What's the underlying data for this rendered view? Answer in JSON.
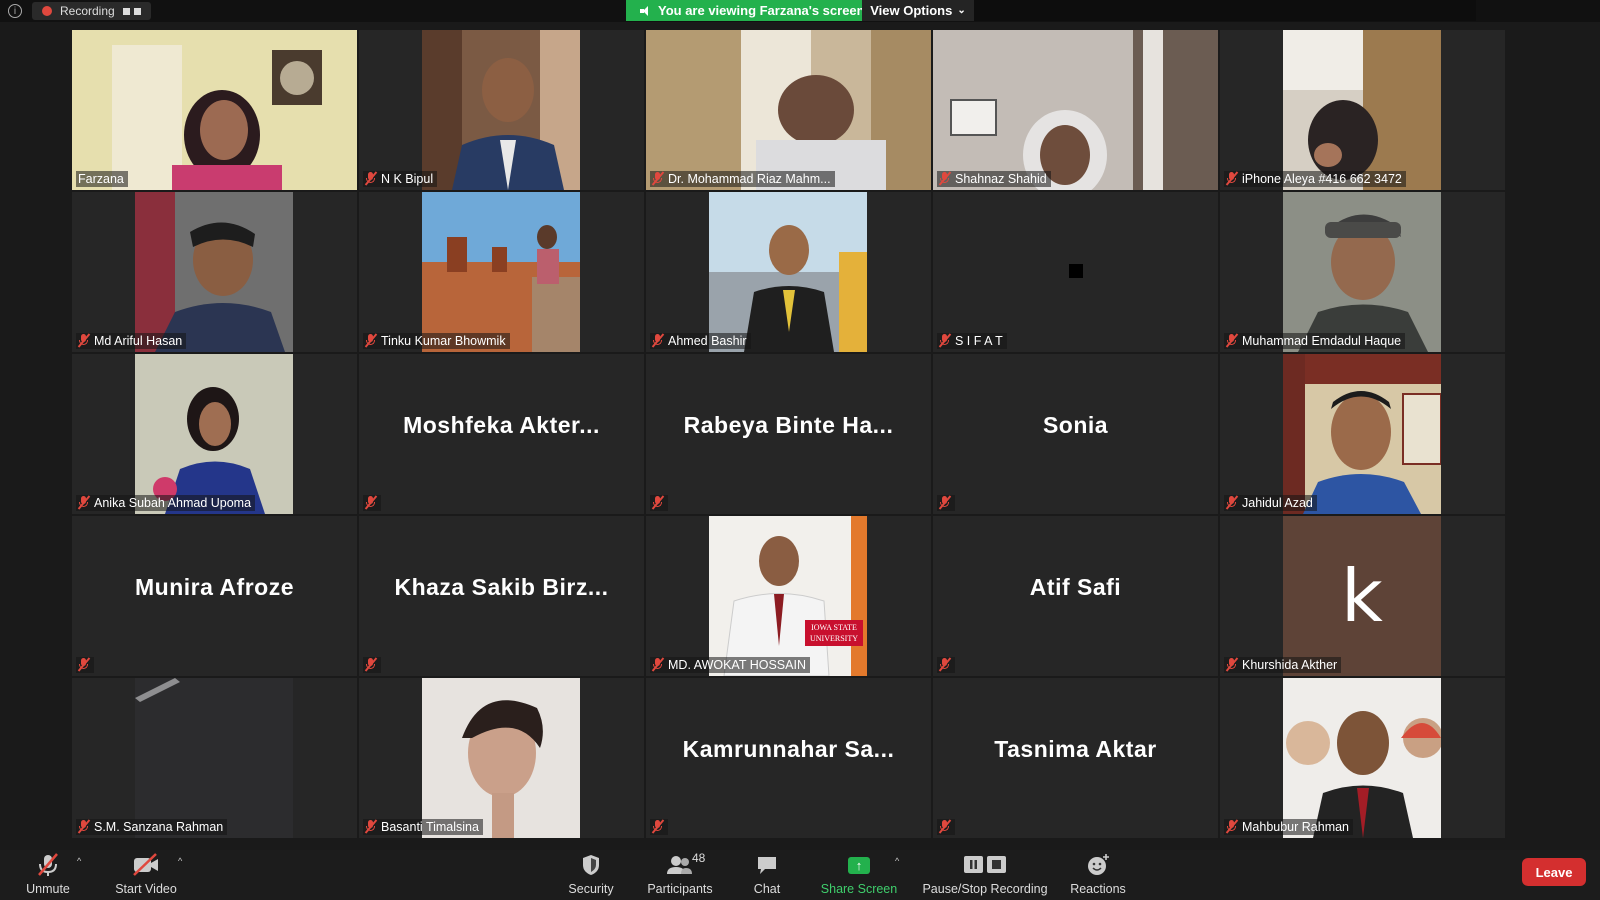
{
  "topbar": {
    "recording_label": "Recording",
    "viewing_text": "You are viewing Farzana's screen",
    "view_options_label": "View Options"
  },
  "participants": [
    {
      "name": "Farzana",
      "kind": "video",
      "muted": false,
      "active_speaker": true
    },
    {
      "name": "N K Bipul",
      "kind": "video",
      "muted": true
    },
    {
      "name": "Dr. Mohammad Riaz Mahm...",
      "kind": "video",
      "muted": true
    },
    {
      "name": "Shahnaz Shahid",
      "kind": "video",
      "muted": true
    },
    {
      "name": "iPhone Aleya #416 662 3472",
      "kind": "video",
      "muted": true
    },
    {
      "name": "Md Ariful Hasan",
      "kind": "video",
      "muted": true
    },
    {
      "name": "Tinku Kumar Bhowmik",
      "kind": "video",
      "muted": true
    },
    {
      "name": "Ahmed Bashir",
      "kind": "video",
      "muted": true
    },
    {
      "name": "S I F A T",
      "kind": "video-off",
      "muted": true
    },
    {
      "name": "Muhammad Emdadul Haque",
      "kind": "video",
      "muted": true
    },
    {
      "name": "Anika Subah Ahmad Upoma",
      "kind": "video",
      "muted": true
    },
    {
      "name": "Moshfeka Akter...",
      "kind": "name-only",
      "muted": true
    },
    {
      "name": "Rabeya Binte Ha...",
      "kind": "name-only",
      "muted": true
    },
    {
      "name": "Sonia",
      "kind": "name-only",
      "muted": true
    },
    {
      "name": "Jahidul Azad",
      "kind": "video",
      "muted": true
    },
    {
      "name": "Munira Afroze",
      "kind": "name-only",
      "muted": true
    },
    {
      "name": "Khaza Sakib Birz...",
      "kind": "name-only",
      "muted": true
    },
    {
      "name": "MD. AWOKAT HOSSAIN",
      "kind": "video",
      "muted": true,
      "badge": "IOWA STATE UNIVERSITY"
    },
    {
      "name": "Atif Safi",
      "kind": "name-only",
      "muted": true
    },
    {
      "name": "Khurshida Akther",
      "kind": "avatar",
      "initial": "k",
      "muted": true
    },
    {
      "name": "S.M. Sanzana Rahman",
      "kind": "video",
      "muted": true
    },
    {
      "name": "Basanti Timalsina",
      "kind": "video",
      "muted": true
    },
    {
      "name": "Kamrunnahar Sa...",
      "kind": "name-only",
      "muted": true
    },
    {
      "name": "Tasnima Aktar",
      "kind": "name-only",
      "muted": true
    },
    {
      "name": "Mahbubur Rahman",
      "kind": "video",
      "muted": true
    }
  ],
  "toolbar": {
    "unmute_label": "Unmute",
    "start_video_label": "Start Video",
    "security_label": "Security",
    "participants_label": "Participants",
    "participants_count": "48",
    "chat_label": "Chat",
    "share_label": "Share Screen",
    "recording_label": "Pause/Stop Recording",
    "reactions_label": "Reactions",
    "leave_label": "Leave"
  },
  "colors": {
    "accent_green": "#23b14d",
    "muted_red": "#e0483e",
    "leave_red": "#d42f2f",
    "active_outline": "#d7db5a"
  }
}
